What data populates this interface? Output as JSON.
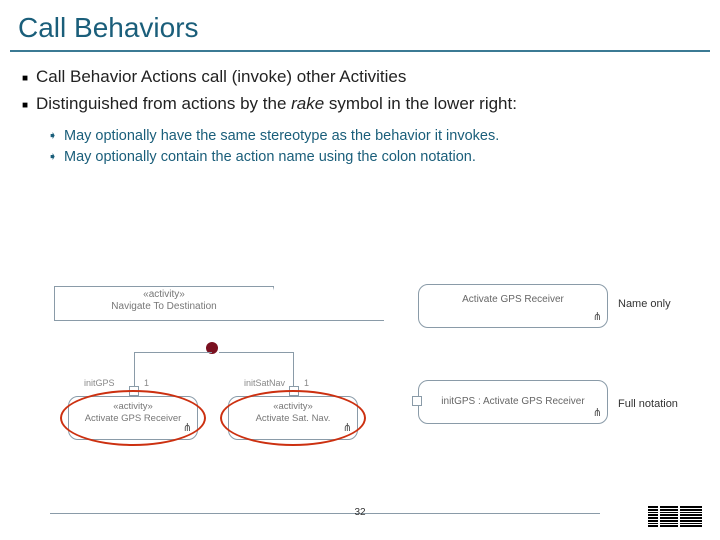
{
  "title": "Call Behaviors",
  "bullets": {
    "a": "Call Behavior Actions call (invoke) other Activities",
    "b_pre": "Distinguished from actions by the ",
    "b_em": "rake",
    "b_post": " symbol in the lower right:"
  },
  "sub": {
    "a": "May optionally have the same stereotype as the behavior it invokes.",
    "b": "May optionally contain the action name using the colon notation."
  },
  "left": {
    "frametab_stereo": "«activity»",
    "frametab_name": "Navigate To Destination",
    "pin1": "initGPS",
    "pin2": "initSatNav",
    "one": "1",
    "cb1_stereo": "«activity»",
    "cb1_name": "Activate GPS Receiver",
    "cb2_stereo": "«activity»",
    "cb2_name": "Activate Sat. Nav."
  },
  "right": {
    "box1": "Activate GPS Receiver",
    "box2": "initGPS : Activate GPS Receiver",
    "label1": "Name only",
    "label2": "Full notation"
  },
  "rake": "⋔",
  "page": "32",
  "logo": "IBM"
}
